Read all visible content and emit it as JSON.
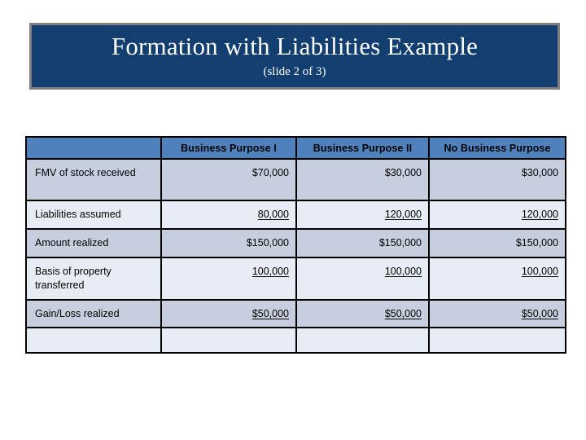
{
  "slide": {
    "title": "Formation with Liabilities Example",
    "subtitle": "(slide 2 of 3)",
    "banner_color": "#123f70",
    "banner_border_color": "#808080",
    "title_text_color": "#ffffff"
  },
  "table": {
    "header_background": "#4f81bd",
    "header_text_color": "#ffffff",
    "row_shade_dark": "#c7cfde",
    "row_shade_light": "#e7ebf3",
    "border_color": "#000000",
    "columns": [
      "",
      "Business Purpose I",
      "Business Purpose II",
      "No Business Purpose"
    ],
    "rows": [
      {
        "label": "FMV of stock received",
        "values": [
          "$70,000",
          "$30,000",
          "$30,000"
        ],
        "underlined": false
      },
      {
        "label": "Liabilities assumed",
        "values": [
          "80,000",
          "120,000",
          "120,000"
        ],
        "underlined": true
      },
      {
        "label": "Amount realized",
        "values": [
          "$150,000",
          "$150,000",
          "$150,000"
        ],
        "underlined": false
      },
      {
        "label": "Basis of property transferred",
        "values": [
          "100,000",
          "100,000",
          "100,000"
        ],
        "underlined": true
      },
      {
        "label": "Gain/Loss realized",
        "values": [
          "$50,000",
          "$50,000",
          "$50,000"
        ],
        "underlined": true
      },
      {
        "label": "",
        "values": [
          "",
          "",
          ""
        ],
        "underlined": false
      }
    ]
  }
}
